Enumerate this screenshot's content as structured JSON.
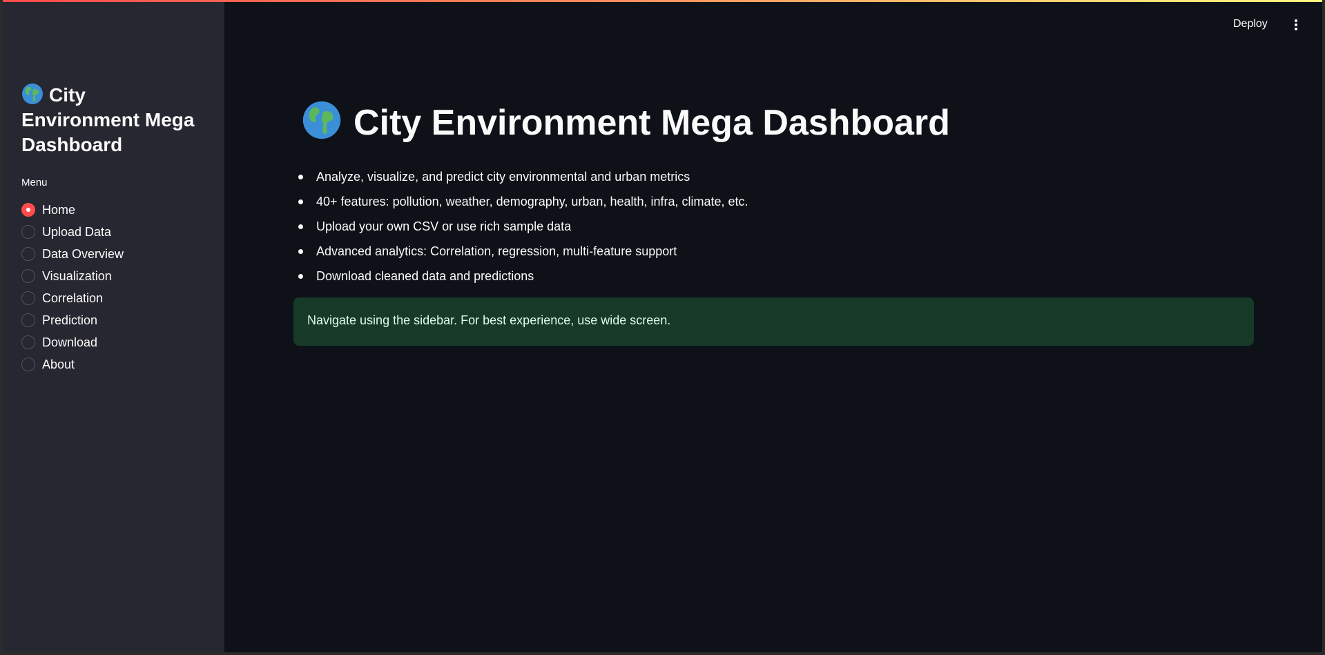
{
  "sidebar": {
    "title": "City Environment Mega Dashboard",
    "menu_label": "Menu",
    "items": [
      {
        "label": "Home",
        "selected": true
      },
      {
        "label": "Upload Data",
        "selected": false
      },
      {
        "label": "Data Overview",
        "selected": false
      },
      {
        "label": "Visualization",
        "selected": false
      },
      {
        "label": "Correlation",
        "selected": false
      },
      {
        "label": "Prediction",
        "selected": false
      },
      {
        "label": "Download",
        "selected": false
      },
      {
        "label": "About",
        "selected": false
      }
    ]
  },
  "toolbar": {
    "deploy_label": "Deploy",
    "more_icon": "vertical-ellipsis-icon"
  },
  "main": {
    "title": "City Environment Mega Dashboard",
    "title_icon": "globe-icon",
    "bullets": [
      "Analyze, visualize, and predict city environmental and urban metrics",
      "40+ features: pollution, weather, demography, urban, health, infra, climate, etc.",
      "Upload your own CSV or use rich sample data",
      "Advanced analytics: Correlation, regression, multi-feature support",
      "Download cleaned data and predictions"
    ],
    "info_message": "Navigate using the sidebar. For best experience, use wide screen."
  },
  "colors": {
    "background": "#0e1117",
    "sidebar": "#262730",
    "accent": "#ff4b4b",
    "info_bg": "#173928",
    "info_text": "#dffde9"
  }
}
